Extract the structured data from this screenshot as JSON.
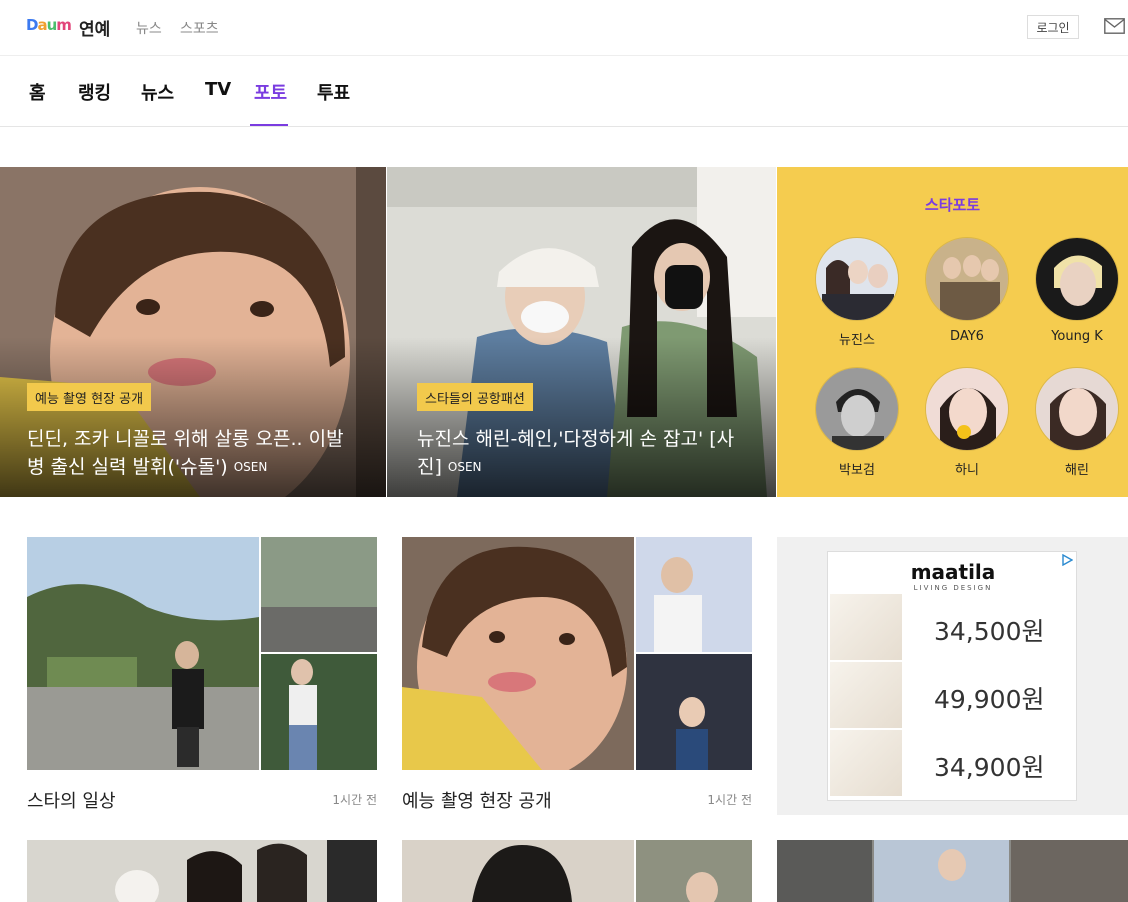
{
  "header": {
    "logo": {
      "d": "D",
      "a": "a",
      "u": "u",
      "m": "m"
    },
    "section": "연예",
    "links": [
      "뉴스",
      "스포츠"
    ],
    "login": "로그인"
  },
  "nav": {
    "items": [
      "홈",
      "랭킹",
      "뉴스",
      "TV",
      "포토",
      "투표"
    ],
    "active": "포토"
  },
  "hero": [
    {
      "tag": "예능 촬영 현장 공개",
      "title": "딘딘, 조카 니꼴로 위해 살롱 오픈.. 이발병 출신 실력 발휘('슈돌')",
      "source": "OSEN"
    },
    {
      "tag": "스타들의 공항패션",
      "title": "뉴진스 해린-혜인,'다정하게 손 잡고' [사진]",
      "source": "OSEN"
    }
  ],
  "star_photo": {
    "title": "스타포토",
    "stars": [
      {
        "name": "뉴진스"
      },
      {
        "name": "DAY6"
      },
      {
        "name": "Young K"
      },
      {
        "name": "박보검"
      },
      {
        "name": "하니"
      },
      {
        "name": "해린"
      }
    ]
  },
  "cards": [
    {
      "caption": "스타의 일상",
      "time": "1시간 전"
    },
    {
      "caption": "예능 촬영 현장 공개",
      "time": "1시간 전"
    }
  ],
  "ad": {
    "brand": "maatila",
    "brand_sub": "LIVING DESIGN",
    "prices": [
      "34,500원",
      "49,900원",
      "34,900원"
    ]
  },
  "colors": {
    "accent": "#7a3ce0",
    "tag": "#f2c94c",
    "panel": "#f5cc4f"
  }
}
